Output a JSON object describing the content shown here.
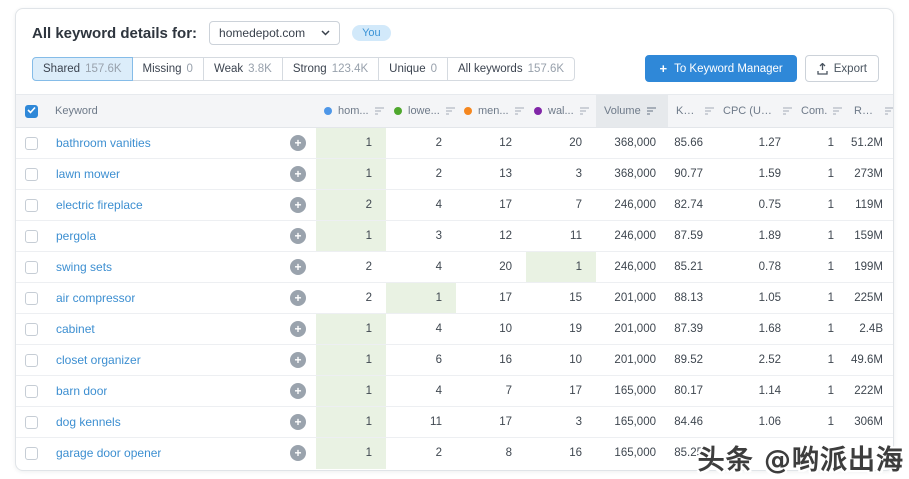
{
  "page": {
    "title": "All keyword details for:",
    "domain_selector": {
      "value": "homedepot.com",
      "badge": "You"
    },
    "tabs": [
      {
        "label": "Shared",
        "count": "157.6K",
        "active": true
      },
      {
        "label": "Missing",
        "count": "0",
        "active": false
      },
      {
        "label": "Weak",
        "count": "3.8K",
        "active": false
      },
      {
        "label": "Strong",
        "count": "123.4K",
        "active": false
      },
      {
        "label": "Unique",
        "count": "0",
        "active": false
      },
      {
        "label": "All keywords",
        "count": "157.6K",
        "active": false
      }
    ],
    "actions": {
      "keyword_manager": "To Keyword Manager",
      "export": "Export"
    }
  },
  "table": {
    "columns": [
      {
        "id": "keyword",
        "label": "Keyword"
      },
      {
        "id": "hom",
        "label": "hom...",
        "dot_color": "#4e97e8"
      },
      {
        "id": "lowe",
        "label": "lowe...",
        "dot_color": "#4fa82e"
      },
      {
        "id": "men",
        "label": "men...",
        "dot_color": "#f5871f"
      },
      {
        "id": "wal",
        "label": "wal...",
        "dot_color": "#8126a8"
      },
      {
        "id": "volume",
        "label": "Volume",
        "sorted": true
      },
      {
        "id": "kd",
        "label": "KD%"
      },
      {
        "id": "cpc",
        "label": "CPC (USD)"
      },
      {
        "id": "com",
        "label": "Com."
      },
      {
        "id": "results",
        "label": "Results"
      }
    ],
    "rows": [
      {
        "keyword": "bathroom vanities",
        "hom": "1",
        "lowe": "2",
        "men": "12",
        "wal": "20",
        "volume": "368,000",
        "kd": "85.66",
        "cpc": "1.27",
        "com": "1",
        "results": "51.2M",
        "best": "hom"
      },
      {
        "keyword": "lawn mower",
        "hom": "1",
        "lowe": "2",
        "men": "13",
        "wal": "3",
        "volume": "368,000",
        "kd": "90.77",
        "cpc": "1.59",
        "com": "1",
        "results": "273M",
        "best": "hom"
      },
      {
        "keyword": "electric fireplace",
        "hom": "2",
        "lowe": "4",
        "men": "17",
        "wal": "7",
        "volume": "246,000",
        "kd": "82.74",
        "cpc": "0.75",
        "com": "1",
        "results": "119M",
        "best": "hom"
      },
      {
        "keyword": "pergola",
        "hom": "1",
        "lowe": "3",
        "men": "12",
        "wal": "11",
        "volume": "246,000",
        "kd": "87.59",
        "cpc": "1.89",
        "com": "1",
        "results": "159M",
        "best": "hom"
      },
      {
        "keyword": "swing sets",
        "hom": "2",
        "lowe": "4",
        "men": "20",
        "wal": "1",
        "volume": "246,000",
        "kd": "85.21",
        "cpc": "0.78",
        "com": "1",
        "results": "199M",
        "best": "wal"
      },
      {
        "keyword": "air compressor",
        "hom": "2",
        "lowe": "1",
        "men": "17",
        "wal": "15",
        "volume": "201,000",
        "kd": "88.13",
        "cpc": "1.05",
        "com": "1",
        "results": "225M",
        "best": "lowe"
      },
      {
        "keyword": "cabinet",
        "hom": "1",
        "lowe": "4",
        "men": "10",
        "wal": "19",
        "volume": "201,000",
        "kd": "87.39",
        "cpc": "1.68",
        "com": "1",
        "results": "2.4B",
        "best": "hom"
      },
      {
        "keyword": "closet organizer",
        "hom": "1",
        "lowe": "6",
        "men": "16",
        "wal": "10",
        "volume": "201,000",
        "kd": "89.52",
        "cpc": "2.52",
        "com": "1",
        "results": "49.6M",
        "best": "hom"
      },
      {
        "keyword": "barn door",
        "hom": "1",
        "lowe": "4",
        "men": "7",
        "wal": "17",
        "volume": "165,000",
        "kd": "80.17",
        "cpc": "1.14",
        "com": "1",
        "results": "222M",
        "best": "hom"
      },
      {
        "keyword": "dog kennels",
        "hom": "1",
        "lowe": "11",
        "men": "17",
        "wal": "3",
        "volume": "165,000",
        "kd": "84.46",
        "cpc": "1.06",
        "com": "1",
        "results": "306M",
        "best": "hom"
      },
      {
        "keyword": "garage door opener",
        "hom": "1",
        "lowe": "2",
        "men": "8",
        "wal": "16",
        "volume": "165,000",
        "kd": "85.25",
        "cpc": "",
        "com": "",
        "results": "",
        "best": "hom"
      }
    ]
  },
  "watermark": "头条 @哟派出海",
  "colors": {
    "primary_blue": "#2f88d8",
    "selected_tab_bg": "#dcedfa",
    "selected_tab_border": "#85bce8",
    "green_highlight": "#e9f2e3",
    "keyword_link": "#3d8fd1",
    "you_badge_bg": "#d2e9fa",
    "you_badge_text": "#3a93d6"
  }
}
